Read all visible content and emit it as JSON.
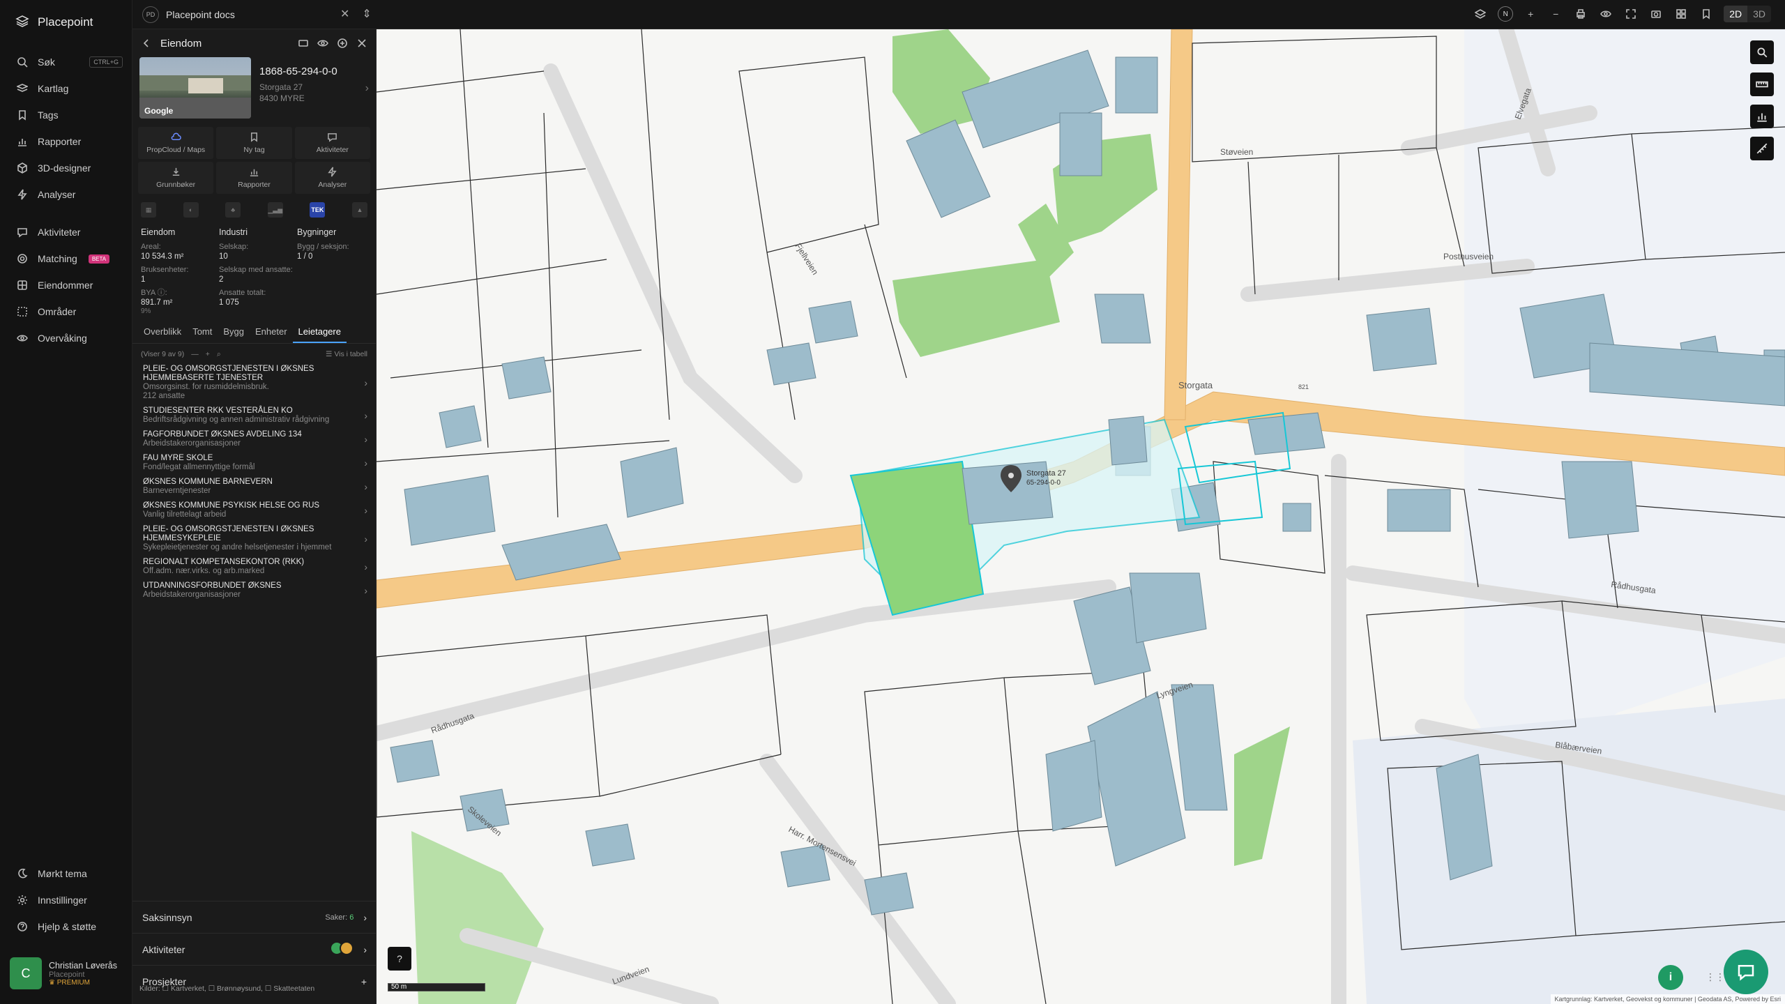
{
  "app": {
    "name": "Placepoint"
  },
  "nav": {
    "items": [
      {
        "label": "Søk",
        "shortcut": "CTRL+G",
        "icon": "search-icon"
      },
      {
        "label": "Kartlag",
        "icon": "layers-icon"
      },
      {
        "label": "Tags",
        "icon": "bookmark-icon"
      },
      {
        "label": "Rapporter",
        "icon": "chart-icon"
      },
      {
        "label": "3D-designer",
        "icon": "cube-icon"
      },
      {
        "label": "Analyser",
        "icon": "bolt-icon"
      },
      {
        "label": "Aktiviteter",
        "icon": "activity-icon"
      },
      {
        "label": "Matching",
        "badge": "BETA",
        "icon": "target-icon"
      },
      {
        "label": "Eiendommer",
        "icon": "grid-icon"
      },
      {
        "label": "Områder",
        "icon": "area-icon"
      },
      {
        "label": "Overvåking",
        "icon": "eye-icon"
      }
    ],
    "bottom": [
      {
        "label": "Mørkt tema",
        "icon": "moon-icon"
      },
      {
        "label": "Innstillinger",
        "icon": "gear-icon"
      },
      {
        "label": "Hjelp & støtte",
        "icon": "help-icon"
      }
    ],
    "user": {
      "initial": "C",
      "name": "Christian Løverås",
      "org": "Placepoint",
      "plan": "PREMIUM"
    }
  },
  "topbar": {
    "workspace_badge": "PD",
    "workspace": "Placepoint docs",
    "view_modes": [
      "2D",
      "3D"
    ],
    "active_view": "2D",
    "compass": "N"
  },
  "panel": {
    "title": "Eiendom",
    "photo_credit": "Google",
    "property": {
      "id": "1868-65-294-0-0",
      "street": "Storgata 27",
      "postal": "8430 MYRE"
    },
    "actions": [
      {
        "label": "PropCloud / Maps",
        "icon": "cloud-icon"
      },
      {
        "label": "Ny tag",
        "icon": "bookmark-icon"
      },
      {
        "label": "Aktiviteter",
        "icon": "chat-icon"
      },
      {
        "label": "Grunnbøker",
        "icon": "download-icon"
      },
      {
        "label": "Rapporter",
        "icon": "chart-icon"
      },
      {
        "label": "Analyser",
        "icon": "bolt-icon"
      }
    ],
    "category_badge": "TEK",
    "stats": {
      "eiendom": {
        "heading": "Eiendom",
        "areal_label": "Areal:",
        "areal": "10 534.3 m²",
        "bruks_label": "Bruksenheter:",
        "bruks": "1",
        "bya_label": "BYA ⓘ:",
        "bya": "891.7 m²",
        "bya_pct": "9%"
      },
      "industri": {
        "heading": "Industri",
        "selskap_label": "Selskap:",
        "selskap": "10",
        "ansatte_label": "Selskap med ansatte:",
        "ansatte": "2",
        "totalt_label": "Ansatte totalt:",
        "totalt": "1 075"
      },
      "bygninger": {
        "heading": "Bygninger",
        "bygg_label": "Bygg / seksjon:",
        "bygg": "1 / 0"
      }
    },
    "tabs": [
      "Overblikk",
      "Tomt",
      "Bygg",
      "Enheter",
      "Leietagere"
    ],
    "active_tab": "Leietagere",
    "list_count": "(Viser 9 av 9)",
    "list_view_label": "Vis i tabell",
    "tenants": [
      {
        "name": "PLEIE- OG OMSORGSTJENESTEN I ØKSNES HJEMMEBASERTE TJENESTER",
        "desc": "Omsorgsinst. for rusmiddelmisbruk.",
        "extra": "212 ansatte"
      },
      {
        "name": "STUDIESENTER RKK VESTERÅLEN KO",
        "desc": "Bedriftsrådgivning og annen administrativ rådgivning",
        "extra": ""
      },
      {
        "name": "FAGFORBUNDET ØKSNES AVDELING 134",
        "desc": "Arbeidstakerorganisasjoner",
        "extra": ""
      },
      {
        "name": "FAU MYRE SKOLE",
        "desc": "Fond/legat allmennyttige formål",
        "extra": ""
      },
      {
        "name": "ØKSNES KOMMUNE BARNEVERN",
        "desc": "Barneverntjenester",
        "extra": ""
      },
      {
        "name": "ØKSNES KOMMUNE PSYKISK HELSE OG RUS",
        "desc": "Vanlig tilrettelagt arbeid",
        "extra": ""
      },
      {
        "name": "PLEIE- OG OMSORGSTJENESTEN I ØKSNES HJEMMESYKEPLEIE",
        "desc": "Sykepleietjenester og andre helsetjenester i hjemmet",
        "extra": ""
      },
      {
        "name": "REGIONALT KOMPETANSEKONTOR (RKK)",
        "desc": "Off.adm. nær.virks. og arb.marked",
        "extra": ""
      },
      {
        "name": "UTDANNINGSFORBUNDET ØKSNES",
        "desc": "Arbeidstakerorganisasjoner",
        "extra": ""
      }
    ],
    "saksinnsyn": {
      "label": "Saksinnsyn",
      "count_label": "Saker:",
      "count": "6"
    },
    "aktiviteter": {
      "label": "Aktiviteter"
    },
    "prosjekter": {
      "label": "Prosjekter"
    },
    "sources": "Kilder: ☐ Kartverket, ☐ Brønnøysund, ☐ Skatteetaten"
  },
  "map": {
    "marker": {
      "label1": "Storgata 27",
      "label2": "65-294-0-0"
    },
    "roads": [
      "Storgata",
      "Fjellveien",
      "Posthusveien",
      "Støveien",
      "Elvegata",
      "Rådhusgata",
      "Rådhusgata",
      "Lyngveien",
      "Blåbærveien",
      "Harr. Mortensensvei",
      "Skoleveien",
      "Lundveien"
    ],
    "route_no": "821",
    "scale": "50 m",
    "attribution": "Kartgrunnlag: Kartverket, Geovekst og kommuner | Geodata AS, Powered by Esri",
    "accent": "#16c7d6",
    "building_color": "#9dbccb"
  }
}
